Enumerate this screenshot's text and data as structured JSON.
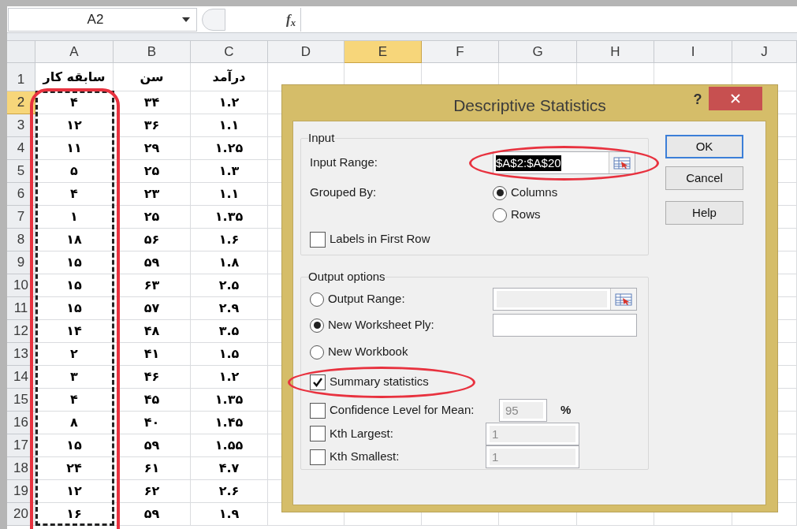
{
  "formula_bar": {
    "name_box": "A2",
    "function_label": "f$_{x}$"
  },
  "columns": {
    "A": {
      "label": "A",
      "selected": false
    },
    "B": {
      "label": "B",
      "selected": false
    },
    "C": {
      "label": "C",
      "selected": false
    },
    "D": {
      "label": "D",
      "selected": false
    },
    "E": {
      "label": "E",
      "selected": true
    },
    "F": {
      "label": "F",
      "selected": false
    },
    "G": {
      "label": "G",
      "selected": false
    },
    "H": {
      "label": "H",
      "selected": false
    },
    "I": {
      "label": "I",
      "selected": false
    },
    "J": {
      "label": "J",
      "selected": false
    }
  },
  "rows": [
    {
      "label": "1",
      "selected": false,
      "cells": {
        "A": "سابقه کار",
        "B": "سن",
        "C": "درآمد"
      }
    },
    {
      "label": "2",
      "selected": true,
      "cells": {
        "A": "۴",
        "B": "۳۴",
        "C": "۱.۲"
      }
    },
    {
      "label": "3",
      "selected": false,
      "cells": {
        "A": "۱۲",
        "B": "۳۶",
        "C": "۱.۱"
      }
    },
    {
      "label": "4",
      "selected": false,
      "cells": {
        "A": "۱۱",
        "B": "۲۹",
        "C": "۱.۲۵"
      }
    },
    {
      "label": "5",
      "selected": false,
      "cells": {
        "A": "۵",
        "B": "۲۵",
        "C": "۱.۳"
      }
    },
    {
      "label": "6",
      "selected": false,
      "cells": {
        "A": "۴",
        "B": "۲۳",
        "C": "۱.۱"
      }
    },
    {
      "label": "7",
      "selected": false,
      "cells": {
        "A": "۱",
        "B": "۲۵",
        "C": "۱.۳۵"
      }
    },
    {
      "label": "8",
      "selected": false,
      "cells": {
        "A": "۱۸",
        "B": "۵۶",
        "C": "۱.۶"
      }
    },
    {
      "label": "9",
      "selected": false,
      "cells": {
        "A": "۱۵",
        "B": "۵۹",
        "C": "۱.۸"
      }
    },
    {
      "label": "10",
      "selected": false,
      "cells": {
        "A": "۱۵",
        "B": "۶۳",
        "C": "۲.۵"
      }
    },
    {
      "label": "11",
      "selected": false,
      "cells": {
        "A": "۱۵",
        "B": "۵۷",
        "C": "۲.۹"
      }
    },
    {
      "label": "12",
      "selected": false,
      "cells": {
        "A": "۱۴",
        "B": "۴۸",
        "C": "۳.۵"
      }
    },
    {
      "label": "13",
      "selected": false,
      "cells": {
        "A": "۲",
        "B": "۴۱",
        "C": "۱.۵"
      }
    },
    {
      "label": "14",
      "selected": false,
      "cells": {
        "A": "۳",
        "B": "۴۶",
        "C": "۱.۲"
      }
    },
    {
      "label": "15",
      "selected": false,
      "cells": {
        "A": "۴",
        "B": "۴۵",
        "C": "۱.۳۵"
      }
    },
    {
      "label": "16",
      "selected": false,
      "cells": {
        "A": "۸",
        "B": "۴۰",
        "C": "۱.۴۵"
      }
    },
    {
      "label": "17",
      "selected": false,
      "cells": {
        "A": "۱۵",
        "B": "۵۹",
        "C": "۱.۵۵"
      }
    },
    {
      "label": "18",
      "selected": false,
      "cells": {
        "A": "۲۴",
        "B": "۶۱",
        "C": "۴.۷"
      }
    },
    {
      "label": "19",
      "selected": false,
      "cells": {
        "A": "۱۲",
        "B": "۶۲",
        "C": "۲.۶"
      }
    },
    {
      "label": "20",
      "selected": false,
      "cells": {
        "A": "۱۶",
        "B": "۵۹",
        "C": "۱.۹"
      }
    }
  ],
  "copy_marquee": true,
  "column_a_highlighted": true,
  "dialog": {
    "title": "Descriptive Statistics",
    "help_glyph": "?",
    "input_group": {
      "legend": "Input",
      "input_range": {
        "label": "Input Range:",
        "value": "$A$2:$A$20",
        "value_selected": true,
        "highlighted": true
      },
      "grouped_by": {
        "label": "Grouped By:",
        "options": [
          {
            "label": "Columns",
            "selected": true
          },
          {
            "label": "Rows",
            "selected": false
          }
        ]
      },
      "labels_in_first_row": {
        "label": "Labels in First Row",
        "checked": false
      }
    },
    "output_group": {
      "legend": "Output options",
      "items": [
        {
          "kind": "radio",
          "label": "Output Range:",
          "selected": false,
          "field": {
            "kind": "range",
            "disabled": true
          }
        },
        {
          "kind": "radio",
          "label": "New Worksheet Ply:",
          "selected": true,
          "field": {
            "kind": "text",
            "disabled": false
          }
        },
        {
          "kind": "radio",
          "label": "New Workbook",
          "selected": false
        },
        {
          "kind": "checkbox",
          "label": "Summary statistics",
          "checked": true,
          "highlighted": true
        },
        {
          "kind": "checkbox",
          "label": "Confidence Level for Mean:",
          "checked": false,
          "field": {
            "kind": "percent",
            "value": "95",
            "unit": "%",
            "disabled": true
          }
        },
        {
          "kind": "checkbox",
          "label": "Kth Largest:",
          "checked": false,
          "field": {
            "kind": "number",
            "value": "1",
            "disabled": true
          }
        },
        {
          "kind": "checkbox",
          "label": "Kth Smallest:",
          "checked": false,
          "field": {
            "kind": "number",
            "value": "1",
            "disabled": true
          }
        }
      ]
    },
    "buttons": [
      {
        "label": "OK",
        "default": true
      },
      {
        "label": "Cancel",
        "default": false
      },
      {
        "label": "Help",
        "default": false
      }
    ]
  }
}
